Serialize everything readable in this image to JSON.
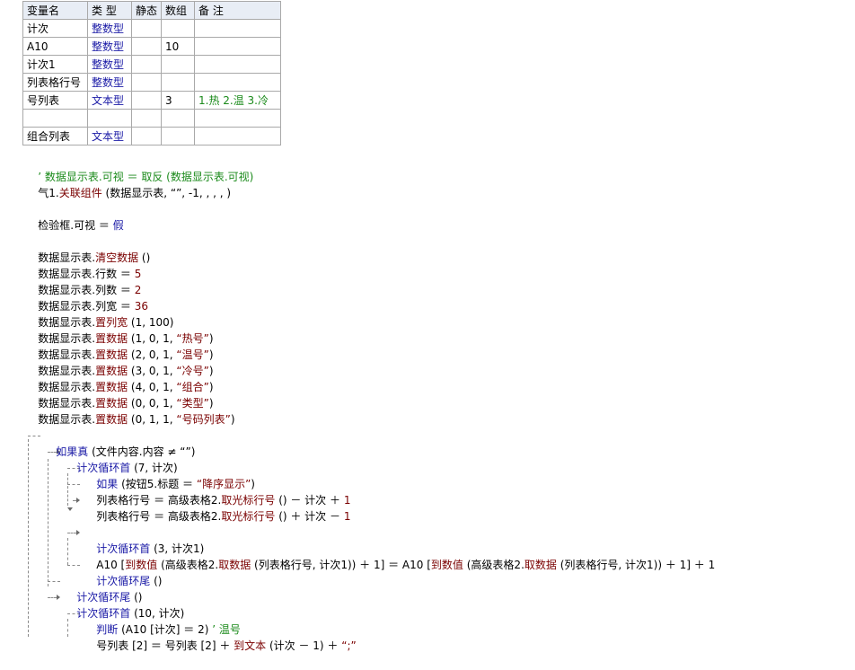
{
  "var_table": {
    "headers": [
      "变量名",
      "类 型",
      "静态",
      "数组",
      "备 注"
    ],
    "rows": [
      {
        "name": "计次",
        "type": "整数型",
        "static": "",
        "array": "",
        "note": ""
      },
      {
        "name": "A10",
        "type": "整数型",
        "static": "",
        "array": "10",
        "note": ""
      },
      {
        "name": "计次1",
        "type": "整数型",
        "static": "",
        "array": "",
        "note": ""
      },
      {
        "name": "列表格行号",
        "type": "整数型",
        "static": "",
        "array": "",
        "note": ""
      },
      {
        "name": "号列表",
        "type": "文本型",
        "static": "",
        "array": "3",
        "note": "1.热 2.温 3.冷"
      },
      {
        "name": "",
        "type": "",
        "static": "",
        "array": "",
        "note": ""
      },
      {
        "name": "组合列表",
        "type": "文本型",
        "static": "",
        "array": "",
        "note": ""
      }
    ]
  },
  "code": {
    "l01": "’ 数据显示表.可视 ＝ 取反 (数据显示表.可视)",
    "l02a": "气1.",
    "l02b": "关联组件",
    "l02c": " (数据显示表, “”, -1, , , , )",
    "l03a": "检验框.可视 ＝ ",
    "l03b": "假",
    "l04a": "数据显示表.",
    "l04b": "清空数据",
    "l04c": " ()",
    "l05a": "数据显示表.行数 ＝ ",
    "l05b": "5",
    "l06a": "数据显示表.列数 ＝ ",
    "l06b": "2",
    "l07a": "数据显示表.列宽 ＝ ",
    "l07b": "36",
    "l08a": "数据显示表.",
    "l08b": "置列宽",
    "l08c": " (1, 100)",
    "l09a": "数据显示表.",
    "l09b": "置数据",
    "l09c": " (1, 0, 1, ",
    "l09d": "“热号”",
    "l09e": ")",
    "l10a": "数据显示表.",
    "l10b": "置数据",
    "l10c": " (2, 0, 1, ",
    "l10d": "“温号”",
    "l10e": ")",
    "l11a": "数据显示表.",
    "l11b": "置数据",
    "l11c": " (3, 0, 1, ",
    "l11d": "“冷号”",
    "l11e": ")",
    "l12a": "数据显示表.",
    "l12b": "置数据",
    "l12c": " (4, 0, 1, ",
    "l12d": "“组合”",
    "l12e": ")",
    "l13a": "数据显示表.",
    "l13b": "置数据",
    "l13c": " (0, 0, 1, ",
    "l13d": "“类型”",
    "l13e": ")",
    "l14a": "数据显示表.",
    "l14b": "置数据",
    "l14c": " (0, 1, 1, ",
    "l14d": "“号码列表”",
    "l14e": ")",
    "l15a": "如果真",
    "l15b": " (文件内容.内容 ≠ “”)",
    "l16a": "计次循环首",
    "l16b": " (7, 计次)",
    "l17a": "如果",
    "l17b": " (按钮5.标题 ＝ ",
    "l17c": "“降序显示”",
    "l17d": ")",
    "l18a": "列表格行号 ＝ 高级表格2.",
    "l18b": "取光标行号",
    "l18c": " () － 计次 ＋ ",
    "l18d": "1",
    "l19a": "列表格行号 ＝ 高级表格2.",
    "l19b": "取光标行号",
    "l19c": " () ＋ 计次 － ",
    "l19d": "1",
    "l20a": "计次循环首",
    "l20b": " (3, 计次1)",
    "l21a": "A10 [",
    "l21b": "到数值",
    "l21c": " (高级表格2.",
    "l21d": "取数据",
    "l21e": " (列表格行号, 计次1)) ＋ 1] ＝ A10 [",
    "l21f": "到数值",
    "l21g": " (高级表格2.",
    "l21h": "取数据",
    "l21i": " (列表格行号, 计次1)) ＋ 1] ＋ 1",
    "l22a": "计次循环尾",
    "l22b": " ()",
    "l23a": "计次循环尾",
    "l23b": " ()",
    "l24a": "计次循环首",
    "l24b": " (10, 计次)",
    "l25a": "判断",
    "l25b": " (A10 [计次] ＝ 2) ",
    "l25c": "’ 温号",
    "l26a": "号列表 [2] ＝ 号列表 [2] ＋ ",
    "l26b": "到文本",
    "l26c": " (计次 － 1) ＋ ",
    "l26d": "“;”"
  }
}
